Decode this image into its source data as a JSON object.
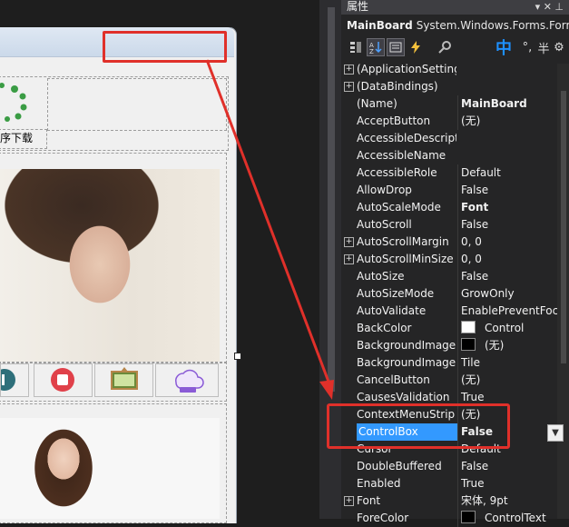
{
  "designer": {
    "loader_label": "序下载"
  },
  "properties": {
    "panel_title": "属性",
    "pin_glyphs": "▾ ✕ ⊥",
    "object_name": "MainBoard",
    "object_type": "System.Windows.Forms.Form",
    "toolbar": {
      "ime_zh": "中",
      "ime_punct": "°,",
      "ime_half": "半",
      "ime_more": "⚙"
    },
    "rows": [
      {
        "name": "(ApplicationSettings)",
        "value": "",
        "expandable": true,
        "bold": false
      },
      {
        "name": "(DataBindings)",
        "value": "",
        "expandable": true,
        "bold": false
      },
      {
        "name": "(Name)",
        "value": "MainBoard",
        "expandable": false,
        "bold": true
      },
      {
        "name": "AcceptButton",
        "value": "(无)",
        "expandable": false,
        "bold": false
      },
      {
        "name": "AccessibleDescription",
        "value": "",
        "expandable": false,
        "bold": false
      },
      {
        "name": "AccessibleName",
        "value": "",
        "expandable": false,
        "bold": false
      },
      {
        "name": "AccessibleRole",
        "value": "Default",
        "expandable": false,
        "bold": false
      },
      {
        "name": "AllowDrop",
        "value": "False",
        "expandable": false,
        "bold": false
      },
      {
        "name": "AutoScaleMode",
        "value": "Font",
        "expandable": false,
        "bold": true
      },
      {
        "name": "AutoScroll",
        "value": "False",
        "expandable": false,
        "bold": false
      },
      {
        "name": "AutoScrollMargin",
        "value": "0, 0",
        "expandable": true,
        "bold": false
      },
      {
        "name": "AutoScrollMinSize",
        "value": "0, 0",
        "expandable": true,
        "bold": false
      },
      {
        "name": "AutoSize",
        "value": "False",
        "expandable": false,
        "bold": false
      },
      {
        "name": "AutoSizeMode",
        "value": "GrowOnly",
        "expandable": false,
        "bold": false
      },
      {
        "name": "AutoValidate",
        "value": "EnablePreventFocusChange",
        "expandable": false,
        "bold": false
      },
      {
        "name": "BackColor",
        "value": "Control",
        "expandable": false,
        "bold": false,
        "swatch": "#ffffff"
      },
      {
        "name": "BackgroundImage",
        "value": "(无)",
        "expandable": false,
        "bold": false,
        "swatch": "#000000"
      },
      {
        "name": "BackgroundImageLayout",
        "value": "Tile",
        "expandable": false,
        "bold": false
      },
      {
        "name": "CancelButton",
        "value": "(无)",
        "expandable": false,
        "bold": false
      },
      {
        "name": "CausesValidation",
        "value": "True",
        "expandable": false,
        "bold": false
      },
      {
        "name": "ContextMenuStrip",
        "value": "(无)",
        "expandable": false,
        "bold": false
      },
      {
        "name": "ControlBox",
        "value": "False",
        "expandable": false,
        "bold": true,
        "selected": true
      },
      {
        "name": "Cursor",
        "value": "Default",
        "expandable": false,
        "bold": false
      },
      {
        "name": "DoubleBuffered",
        "value": "False",
        "expandable": false,
        "bold": false
      },
      {
        "name": "Enabled",
        "value": "True",
        "expandable": false,
        "bold": false
      },
      {
        "name": "Font",
        "value": "宋体, 9pt",
        "expandable": true,
        "bold": false
      },
      {
        "name": "ForeColor",
        "value": "ControlText",
        "expandable": false,
        "bold": false,
        "swatch": "#000000"
      }
    ]
  },
  "colors": {
    "highlight_red": "#e0302a",
    "selection_blue": "#3399ff",
    "panel_bg": "#252526"
  }
}
